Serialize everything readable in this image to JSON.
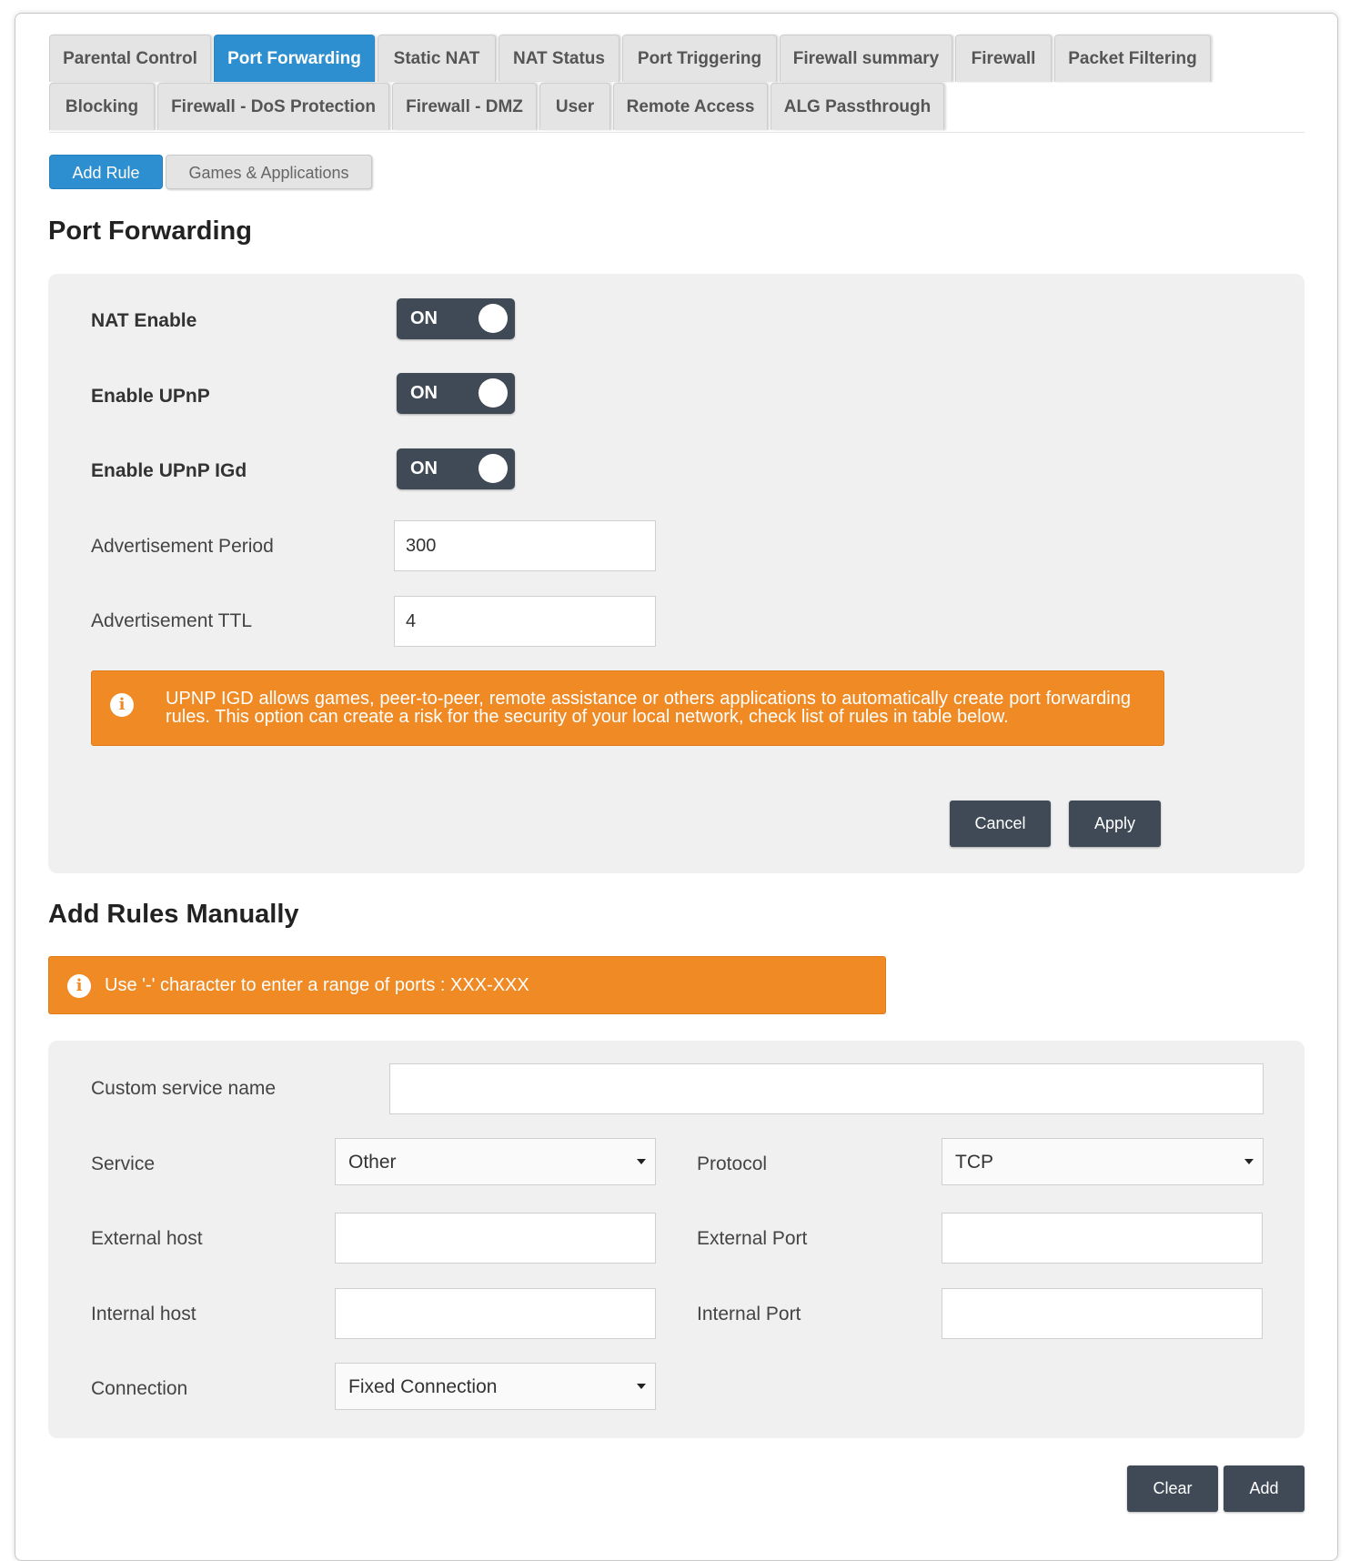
{
  "tabs": {
    "row1": [
      "Parental Control",
      "Port Forwarding",
      "Static NAT",
      "NAT Status",
      "Port Triggering",
      "Firewall summary",
      "Firewall",
      "Packet Filtering"
    ],
    "row2": [
      "Blocking",
      "Firewall - DoS Protection",
      "Firewall - DMZ",
      "User",
      "Remote Access",
      "ALG Passthrough"
    ],
    "active": "Port Forwarding"
  },
  "subtabs": {
    "add_rule": "Add Rule",
    "games_apps": "Games & Applications"
  },
  "port_forwarding": {
    "title": "Port Forwarding",
    "nat_enable": {
      "label": "NAT Enable",
      "state": "ON"
    },
    "enable_upnp": {
      "label": "Enable UPnP",
      "state": "ON"
    },
    "enable_upnp_igd": {
      "label": "Enable UPnP IGd",
      "state": "ON"
    },
    "advertisement_period": {
      "label": "Advertisement Period",
      "value": "300"
    },
    "advertisement_ttl": {
      "label": "Advertisement TTL",
      "value": "4"
    },
    "alert_text": "UPNP IGD allows games, peer-to-peer, remote assistance or others applications to automatically create port forwarding rules. This option can create a risk for the security of your local network, check list of rules in table below.",
    "cancel_label": "Cancel",
    "apply_label": "Apply"
  },
  "manual_rules": {
    "title": "Add Rules Manually",
    "alert_text": "Use '-' character to enter a range of ports : XXX-XXX",
    "custom_service_name": {
      "label": "Custom service name",
      "value": ""
    },
    "service": {
      "label": "Service",
      "value": "Other"
    },
    "protocol": {
      "label": "Protocol",
      "value": "TCP"
    },
    "external_host": {
      "label": "External host",
      "value": ""
    },
    "external_port": {
      "label": "External Port",
      "value": ""
    },
    "internal_host": {
      "label": "Internal host",
      "value": ""
    },
    "internal_port": {
      "label": "Internal Port",
      "value": ""
    },
    "connection": {
      "label": "Connection",
      "value": "Fixed Connection"
    },
    "clear_label": "Clear",
    "add_label": "Add"
  },
  "colors": {
    "accent_blue": "#2d8fcf",
    "alert_orange": "#f08a24",
    "dark_button": "#3f4a56"
  },
  "icons": {
    "alert": "info-icon"
  }
}
